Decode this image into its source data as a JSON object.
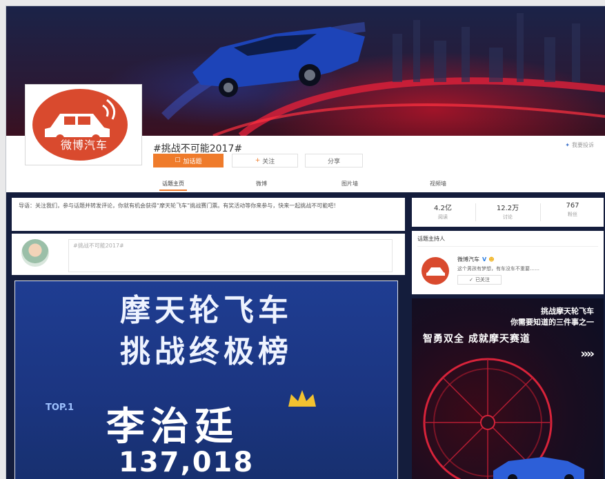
{
  "topic": {
    "title": "#挑战不可能2017#",
    "join_label": "加话题",
    "follow_label": "关注",
    "share_label": "分享",
    "report_label": "我要投诉"
  },
  "avatar": {
    "logo_text": "微博汽车"
  },
  "tabs": [
    {
      "label": "话题主页",
      "active": true
    },
    {
      "label": "微博"
    },
    {
      "label": "图片墙"
    },
    {
      "label": "视频墙"
    }
  ],
  "intro": {
    "text": "导语：关注我们，参与话题并转发评论，你就有机会获得“摩天轮飞车”挑战赛门票。有奖活动等你来参与，快来一起挑战不可能吧！"
  },
  "compose": {
    "placeholder": "#挑战不可能2017#"
  },
  "stats": [
    {
      "value": "4.2亿",
      "label": "阅读"
    },
    {
      "value": "12.2万",
      "label": "讨论"
    },
    {
      "value": "767",
      "label": "粉丝"
    }
  ],
  "host": {
    "title": "话题主持人",
    "name": "微博汽车",
    "desc": "这个男孩有梦想，有车没车不重要……",
    "follow_label": "已关注"
  },
  "poster": {
    "line1": "摩天轮飞车",
    "line2": "挑战终极榜",
    "rank": "TOP.1",
    "winner": "李治廷",
    "score": "137,018"
  },
  "ad": {
    "line1": "挑战摩天轮飞车",
    "line2": "你需要知道的三件事之一",
    "line3": "智勇双全 成就摩天赛道",
    "arrows": "››››"
  },
  "colors": {
    "accent": "#ef7b2b",
    "brand_red": "#d94a2e",
    "page_navy": "#141d3c",
    "poster_blue": "#1f3d92",
    "verified_blue": "#2b7de0"
  }
}
